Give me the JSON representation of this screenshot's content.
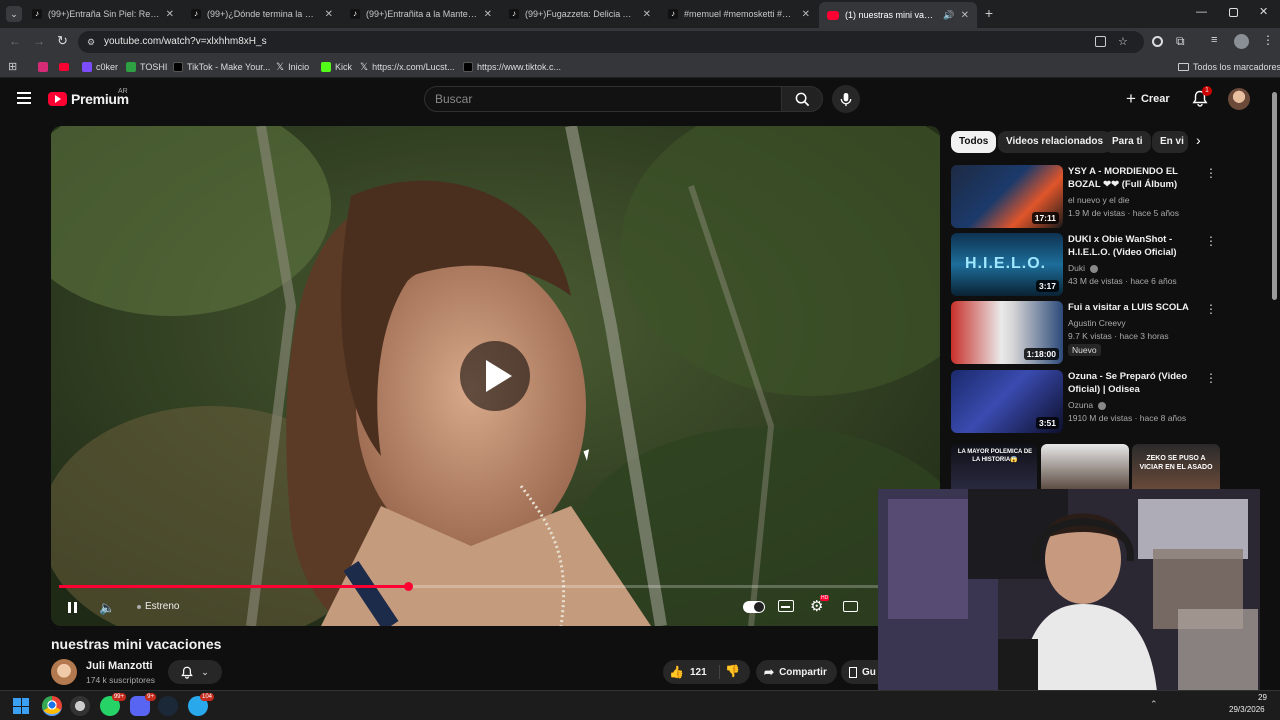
{
  "browser": {
    "tabs": [
      {
        "label": "(99+)Entraña Sin Piel: Recetas y",
        "icon": "tiktok-icon"
      },
      {
        "label": "(99+)¿Dónde termina la máscar",
        "icon": "tiktok-icon"
      },
      {
        "label": "(99+)Entrañita a la Manteca Ro",
        "icon": "tiktok-icon"
      },
      {
        "label": "(99+)Fugazzeta: Delicia Argenti",
        "icon": "tiktok-icon"
      },
      {
        "label": "#memuel #memosketti #marti",
        "icon": "tiktok-icon"
      },
      {
        "label": "(1) nuestras mini vacacione",
        "icon": "youtube-icon",
        "active": true
      }
    ],
    "url": "youtube.com/watch?v=xlxhhm8xH_s",
    "bookmarks": [
      {
        "label": "",
        "icon": "instagram-icon",
        "color": "#d62976"
      },
      {
        "label": "",
        "icon": "youtube-icon",
        "color": "#ff0033"
      },
      {
        "label": "c0ker",
        "icon": "bookmark-c0ker-icon",
        "color": "#7c4dff"
      },
      {
        "label": "TOSHI",
        "icon": "bookmark-toshi-icon",
        "color": "#2ea043"
      },
      {
        "label": "TikTok - Make Your...",
        "icon": "tiktok-icon",
        "color": "#111111"
      },
      {
        "label": "Inicio",
        "icon": "x-icon",
        "color": "#000000"
      },
      {
        "label": "Kick",
        "icon": "kick-icon",
        "color": "#53fc18"
      },
      {
        "label": "https://x.com/Lucst...",
        "icon": "x-icon",
        "color": "#000000"
      },
      {
        "label": "https://www.tiktok.c...",
        "icon": "tiktok-icon",
        "color": "#111111"
      }
    ],
    "all_bookmarks": "Todos los marcadores"
  },
  "youtube": {
    "logo": "Premium",
    "region": "AR",
    "search_placeholder": "Buscar",
    "create_label": "Crear",
    "notifications_count": "1"
  },
  "player": {
    "status_label": "Estreno",
    "progress_fraction": 0.4
  },
  "video": {
    "title": "nuestras mini vacaciones",
    "channel": "Juli Manzotti",
    "subscribers": "174 k suscriptores",
    "likes": "121",
    "share_label": "Compartir",
    "save_label": "Gu"
  },
  "filters": [
    "Todos",
    "Videos relacionados",
    "Para ti",
    "En vi"
  ],
  "recommendations": [
    {
      "title": "YSY A - MORDIENDO EL BOZAL ❤❤ (Full Álbum)",
      "channel": "el nuevo y el die",
      "meta": "1.9 M de vistas · hace 5 años",
      "duration": "17:11",
      "verified": false,
      "badge": ""
    },
    {
      "title": "DUKI x Obie WanShot - H.I.E.L.O. (Video Oficial)",
      "channel": "Duki",
      "meta": "43 M de vistas · hace 6 años",
      "duration": "3:17",
      "verified": true,
      "badge": ""
    },
    {
      "title": "Fui a visitar a LUIS SCOLA",
      "channel": "Agustin Creevy",
      "meta": "9.7 K vistas · hace 3 horas",
      "duration": "1:18:00",
      "verified": false,
      "badge": "Nuevo"
    },
    {
      "title": "Ozuna - Se Preparó (Video Oficial) | Odisea",
      "channel": "Ozuna",
      "meta": "1910 M de vistas · hace 8 años",
      "duration": "3:51",
      "verified": true,
      "badge": ""
    }
  ],
  "shorts": [
    {
      "caption": "LA MAYOR POLEMICA DE LA HISTORIA😱"
    },
    {
      "caption": ""
    },
    {
      "caption": "ZEKO SE PUSO A VICIAR EN EL ASADO"
    }
  ],
  "taskbar": {
    "whatsapp_badge": "99+",
    "discord_badge": "9+",
    "telegram_badge": "104",
    "clock_time": "29",
    "clock_date": "29/3/2026"
  },
  "colors": {
    "accent": "#ff0033",
    "background": "#0f0f0f"
  }
}
